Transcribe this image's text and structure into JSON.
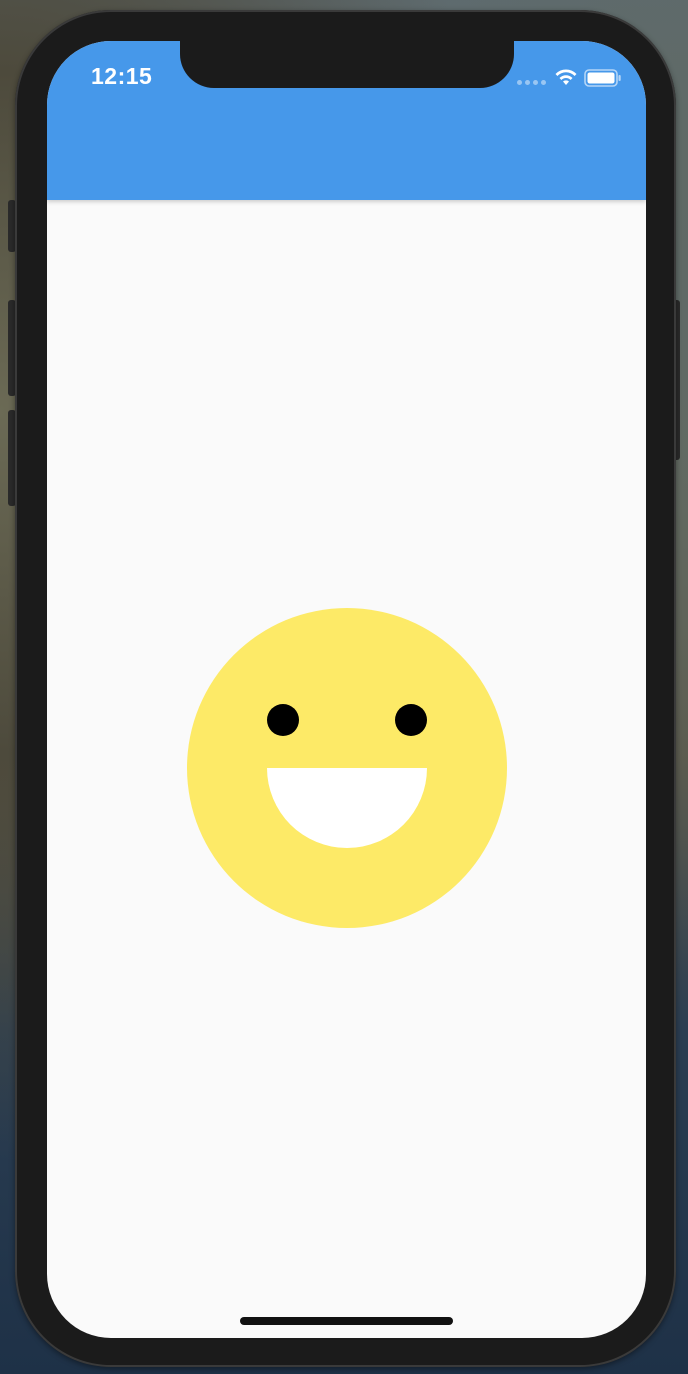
{
  "status_bar": {
    "time": "12:15",
    "icons": [
      "cellular-signal-icon",
      "wifi-icon",
      "battery-icon"
    ]
  },
  "app_bar": {
    "color": "#4698ea"
  },
  "content": {
    "background": "#fafafa",
    "smiley": {
      "face_color": "#fdea67",
      "eye_color": "#000000",
      "mouth_color": "#ffffff"
    }
  }
}
